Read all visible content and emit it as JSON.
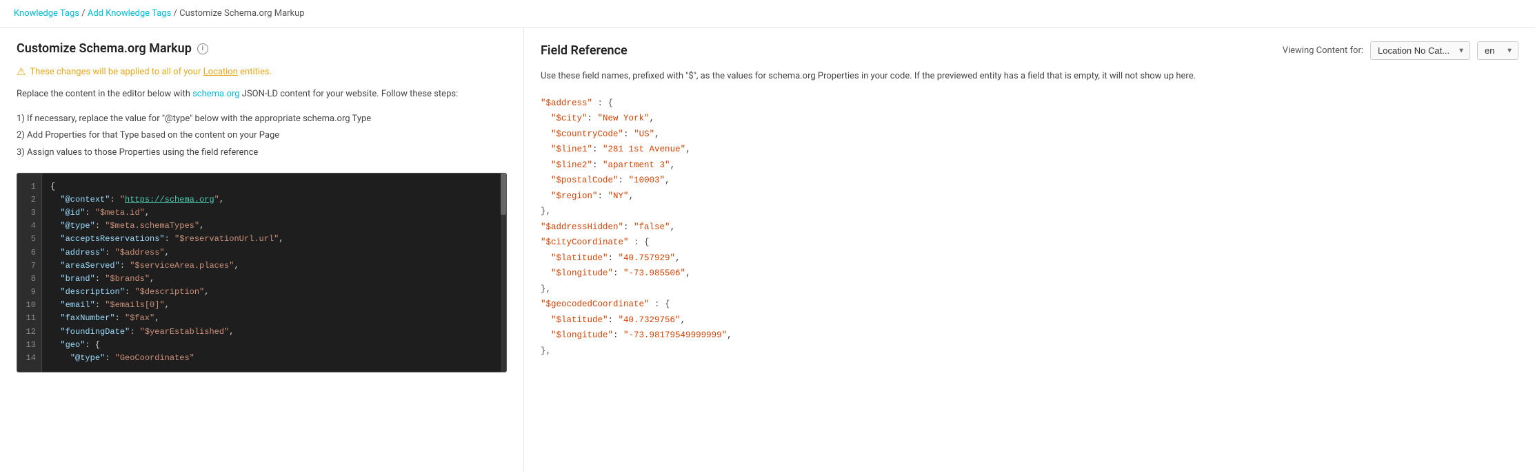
{
  "breadcrumb": {
    "items": [
      {
        "label": "Knowledge Tags",
        "href": "#",
        "link": true
      },
      {
        "label": "Add Knowledge Tags",
        "href": "#",
        "link": true
      },
      {
        "label": "Customize Schema.org Markup",
        "link": false
      }
    ],
    "separator": " / "
  },
  "left_panel": {
    "title": "Customize Schema.org Markup",
    "info_icon_label": "i",
    "warning_text": "These changes will be applied to all of your Location entities.",
    "warning_link_text": "Location",
    "description_before": "Replace the content in the editor below with ",
    "description_link_text": "schema.org",
    "description_after": " JSON-LD content for your website. Follow these steps:",
    "steps": [
      "1) If necessary, replace the value for \"@type\" below with the appropriate schema.org Type",
      "2) Add Properties for that Type based on the content on your Page",
      "3) Assign values to those Properties using the field reference"
    ],
    "code_lines": [
      {
        "num": 1,
        "content": "{"
      },
      {
        "num": 2,
        "content": "  \"@context\": \"https://schema.org\","
      },
      {
        "num": 3,
        "content": "  \"@id\": \"$meta.id\","
      },
      {
        "num": 4,
        "content": "  \"@type\": \"$meta.schemaTypes\","
      },
      {
        "num": 5,
        "content": "  \"acceptsReservations\": \"$reservationUrl.url\","
      },
      {
        "num": 6,
        "content": "  \"address\": \"$address\","
      },
      {
        "num": 7,
        "content": "  \"areaServed\": \"$serviceArea.places\","
      },
      {
        "num": 8,
        "content": "  \"brand\": \"$brands\","
      },
      {
        "num": 9,
        "content": "  \"description\": \"$description\","
      },
      {
        "num": 10,
        "content": "  \"email\": \"$emails[0]\","
      },
      {
        "num": 11,
        "content": "  \"faxNumber\": \"$fax\","
      },
      {
        "num": 12,
        "content": "  \"foundingDate\": \"$yearEstablished\","
      },
      {
        "num": 13,
        "content": "  \"geo\": {"
      },
      {
        "num": 14,
        "content": "    \"@type\": \"GeoCoordinates\""
      }
    ]
  },
  "right_panel": {
    "title": "Field Reference",
    "viewing_label": "Viewing Content for:",
    "dropdown_location": {
      "value": "Location No Cat...",
      "options": [
        "Location No Cat..."
      ]
    },
    "dropdown_lang": {
      "value": "en",
      "options": [
        "en"
      ]
    },
    "description": "Use these field names, prefixed with \"$\", as the values for schema.org Properties in your code. If the previewed entity has a field that is empty, it will not show up here.",
    "field_reference_code": [
      "\"$address\" : {",
      "  \"$city\": \"New York\",",
      "  \"$countryCode\": \"US\",",
      "  \"$line1\": \"281 1st Avenue\",",
      "  \"$line2\": \"apartment 3\",",
      "  \"$postalCode\": \"10003\",",
      "  \"$region\": \"NY\",",
      "},",
      "\"$addressHidden\": \"false\",",
      "\"$cityCoordinate\" : {",
      "  \"$latitude\": \"40.757929\",",
      "  \"$longitude\": \"-73.985506\",",
      "},",
      "\"$geocodedCoordinate\" : {",
      "  \"$latitude\": \"40.7329756\",",
      "  \"$longitude\": \"-73.98179549999999\",",
      "},"
    ]
  }
}
